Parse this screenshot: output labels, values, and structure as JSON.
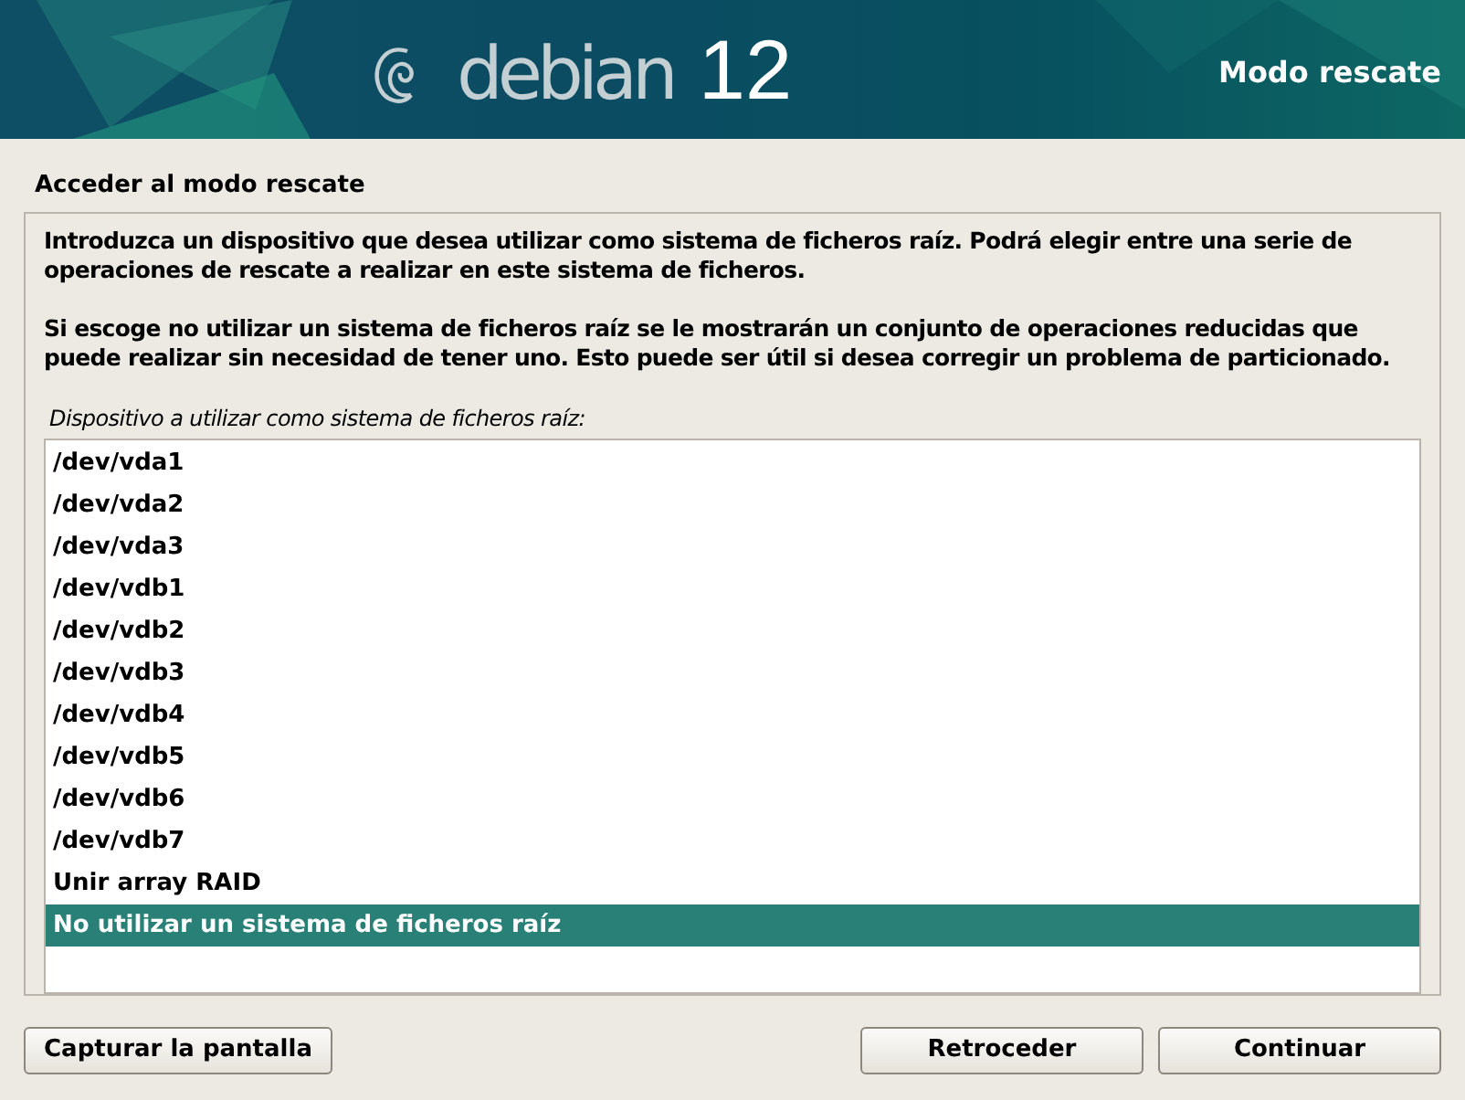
{
  "banner": {
    "logo_text": "debian",
    "version": "12",
    "title": "Modo rescate"
  },
  "page_title": "Acceder al modo rescate",
  "paragraphs": [
    "Introduzca un dispositivo que desea utilizar como sistema de ficheros raíz. Podrá elegir entre una serie de operaciones de rescate a realizar en este sistema de ficheros.",
    "Si escoge no utilizar un sistema de ficheros raíz se le mostrarán un conjunto de operaciones reducidas que puede realizar sin necesidad de tener uno. Esto puede ser útil si desea corregir un problema de particionado."
  ],
  "list_label": "Dispositivo a utilizar como sistema de ficheros raíz:",
  "options": [
    {
      "label": "/dev/vda1",
      "selected": false
    },
    {
      "label": "/dev/vda2",
      "selected": false
    },
    {
      "label": "/dev/vda3",
      "selected": false
    },
    {
      "label": "/dev/vdb1",
      "selected": false
    },
    {
      "label": "/dev/vdb2",
      "selected": false
    },
    {
      "label": "/dev/vdb3",
      "selected": false
    },
    {
      "label": "/dev/vdb4",
      "selected": false
    },
    {
      "label": "/dev/vdb5",
      "selected": false
    },
    {
      "label": "/dev/vdb6",
      "selected": false
    },
    {
      "label": "/dev/vdb7",
      "selected": false
    },
    {
      "label": "Unir array RAID",
      "selected": false
    },
    {
      "label": "No utilizar un sistema de ficheros raíz",
      "selected": true
    }
  ],
  "buttons": {
    "left": [
      "Capturar la pantalla"
    ],
    "right": [
      "Retroceder",
      "Continuar"
    ]
  }
}
